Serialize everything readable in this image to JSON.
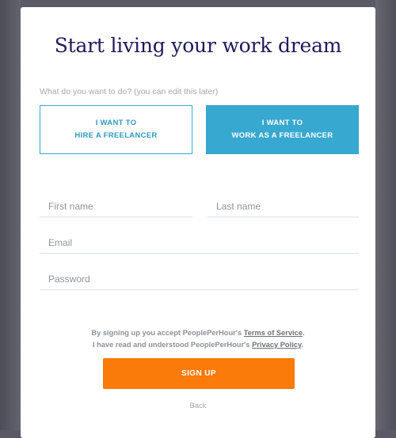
{
  "heading": "Start living your work dream",
  "role_prompt": "What do you want to do? (you can edit this later)",
  "roles": {
    "hire": {
      "line1": "I WANT TO",
      "line2": "HIRE A FREELANCER",
      "selected": false
    },
    "work": {
      "line1": "I WANT TO",
      "line2": "WORK AS A FREELANCER",
      "selected": true
    }
  },
  "fields": {
    "first_name": {
      "placeholder": "First name",
      "value": ""
    },
    "last_name": {
      "placeholder": "Last name",
      "value": ""
    },
    "email": {
      "placeholder": "Email",
      "value": ""
    },
    "password": {
      "placeholder": "Password",
      "value": ""
    }
  },
  "legal": {
    "line1_prefix": "By signing up you accept PeoplePerHour's ",
    "terms_link": "Terms of Service",
    "line1_suffix": ".",
    "line2_prefix": "I have read and understood PeoplePerHour's ",
    "privacy_link": "Privacy Policy",
    "line2_suffix": "."
  },
  "signup_label": "SIGN UP",
  "back_label": "Back",
  "colors": {
    "title": "#1f1a5c",
    "accent_blue": "#37a8cf",
    "cta_orange": "#fa7a0a"
  }
}
